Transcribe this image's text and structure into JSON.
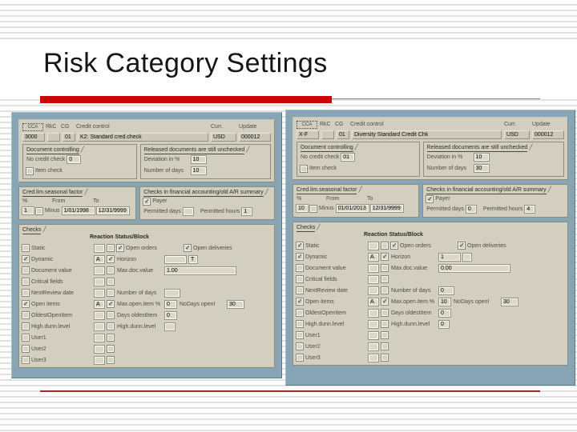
{
  "slide": {
    "title": "Risk Category Settings"
  },
  "panels": [
    {
      "name": "left",
      "header": {
        "icon": "CCA",
        "col_rkc": "RkC",
        "col_cg": "CG",
        "col_desc": "Credit control",
        "col_curr": "Curr.",
        "col_update": "Update",
        "ccar": "3000",
        "rkc": "",
        "cg": "01",
        "desc": "K2: Standard cred.check",
        "curr": "USD",
        "update": "000012"
      },
      "doc_controlling": {
        "title": "Document controlling",
        "no_check_label": "No credit check",
        "no_check_value": "0",
        "item_check_label": "Item check",
        "item_check_checked": false
      },
      "released": {
        "title": "Released documents are still unchecked",
        "deviation_label": "Deviation in %",
        "deviation_value": "10",
        "days_label": "Number of days",
        "days_value": "10"
      },
      "seasonal": {
        "title": "Cred.lim.seasonal factor",
        "pct_label": "%",
        "from_label": "From",
        "to_label": "To",
        "pct_value": "1",
        "minus_label": "Minus",
        "minus_checked": false,
        "from_value": "1/01/1998",
        "to_value": "12/31/9999"
      },
      "fin_summary": {
        "title": "Checks in financial accounting/old A/R summary",
        "payer_label": "Payer",
        "payer_checked": true,
        "days_label": "Permitted days",
        "days_value": "",
        "hours_label": "Permitted hours",
        "hours_value": "1"
      },
      "checks": {
        "title": "Checks",
        "col_header": "Reaction Status/Block",
        "rows": [
          {
            "label": "Static",
            "checked": false,
            "reaction": "",
            "status": false,
            "extras": [
              {
                "kind": "checkbox",
                "label": "Open orders",
                "checked": true
              },
              {
                "kind": "checkbox",
                "label": "Open deliveries",
                "checked": true
              }
            ]
          },
          {
            "label": "Dynamic",
            "checked": true,
            "reaction": "A",
            "status": true,
            "extras": [
              {
                "kind": "field",
                "label": "Horizon",
                "value": "",
                "unit": "T"
              }
            ]
          },
          {
            "label": "Document value",
            "checked": false,
            "reaction": "",
            "status": false,
            "extras": [
              {
                "kind": "field",
                "label": "Max.doc.value",
                "value": "1.00"
              }
            ]
          },
          {
            "label": "Critical fields",
            "checked": false,
            "reaction": "",
            "status": false,
            "extras": []
          },
          {
            "label": "NextReview date",
            "checked": false,
            "reaction": "",
            "status": false,
            "extras": [
              {
                "kind": "field",
                "label": "Number of days",
                "value": ""
              }
            ]
          },
          {
            "label": "Open items",
            "checked": true,
            "reaction": "A",
            "status": true,
            "extras": [
              {
                "kind": "field",
                "label": "Max.open.item %",
                "value": "0"
              },
              {
                "kind": "field",
                "label": "NoDays openI",
                "value": "30"
              }
            ]
          },
          {
            "label": "OldestOpenItem",
            "checked": false,
            "reaction": "",
            "status": false,
            "extras": [
              {
                "kind": "field",
                "label": "Days oldestItem",
                "value": "0"
              }
            ]
          },
          {
            "label": "High.dunn.level",
            "checked": false,
            "reaction": "",
            "status": false,
            "extras": [
              {
                "kind": "field",
                "label": "High.dunn.level",
                "value": ""
              }
            ]
          },
          {
            "label": "User1",
            "checked": false,
            "reaction": "",
            "status": false,
            "extras": []
          },
          {
            "label": "User2",
            "checked": false,
            "reaction": "",
            "status": false,
            "extras": []
          },
          {
            "label": "User3",
            "checked": false,
            "reaction": "",
            "status": false,
            "extras": []
          }
        ]
      }
    },
    {
      "name": "right",
      "header": {
        "icon": "CCA",
        "col_rkc": "RkC",
        "col_cg": "CG",
        "col_desc": "Credit control",
        "col_curr": "Curr.",
        "col_update": "Update",
        "ccar": "X-F",
        "rkc": "",
        "cg": "01",
        "desc": "Diversity Standard Credit Chk",
        "curr": "USD",
        "update": "000012"
      },
      "doc_controlling": {
        "title": "Document controlling",
        "no_check_label": "No credit check",
        "no_check_value": "01",
        "item_check_label": "Item check",
        "item_check_checked": false
      },
      "released": {
        "title": "Released documents are still unchecked",
        "deviation_label": "Deviation in %",
        "deviation_value": "10",
        "days_label": "Number of days",
        "days_value": "30"
      },
      "seasonal": {
        "title": "Cred.lim.seasonal factor",
        "pct_label": "%",
        "from_label": "From",
        "to_label": "To",
        "pct_value": "10",
        "minus_label": "Minus",
        "minus_checked": false,
        "from_value": "01/01/2013",
        "to_value": "12/31/9999"
      },
      "fin_summary": {
        "title": "Checks in financial accounting/old A/R summary",
        "payer_label": "Payer",
        "payer_checked": true,
        "days_label": "Permitted days",
        "days_value": "0",
        "hours_label": "Permitted hours",
        "hours_value": "4"
      },
      "checks": {
        "title": "Checks",
        "col_header": "Reaction Status/Block",
        "rows": [
          {
            "label": "Static",
            "checked": true,
            "reaction": "",
            "status": false,
            "extras": [
              {
                "kind": "checkbox",
                "label": "Open orders",
                "checked": true
              },
              {
                "kind": "checkbox",
                "label": "Open deliveries",
                "checked": true
              }
            ]
          },
          {
            "label": "Dynamic",
            "checked": true,
            "reaction": "A",
            "status": true,
            "extras": [
              {
                "kind": "field",
                "label": "Horizon",
                "value": "1",
                "unit": ""
              }
            ]
          },
          {
            "label": "Document value",
            "checked": false,
            "reaction": "",
            "status": false,
            "extras": [
              {
                "kind": "field",
                "label": "Max.doc.value",
                "value": "0.00"
              }
            ]
          },
          {
            "label": "Critical fields",
            "checked": false,
            "reaction": "",
            "status": false,
            "extras": []
          },
          {
            "label": "NextReview date",
            "checked": false,
            "reaction": "",
            "status": false,
            "extras": [
              {
                "kind": "field",
                "label": "Number of days",
                "value": "0"
              }
            ]
          },
          {
            "label": "Open items",
            "checked": true,
            "reaction": "A",
            "status": true,
            "extras": [
              {
                "kind": "field",
                "label": "Max.open.item %",
                "value": "10"
              },
              {
                "kind": "field",
                "label": "NoDays openI",
                "value": "30"
              }
            ]
          },
          {
            "label": "OldestOpenItem",
            "checked": false,
            "reaction": "",
            "status": false,
            "extras": [
              {
                "kind": "field",
                "label": "Days oldestItem",
                "value": "0"
              }
            ]
          },
          {
            "label": "High.dunn.level",
            "checked": false,
            "reaction": "",
            "status": false,
            "extras": [
              {
                "kind": "field",
                "label": "High.dunn.level",
                "value": "0"
              }
            ]
          },
          {
            "label": "User1",
            "checked": false,
            "reaction": "",
            "status": false,
            "extras": []
          },
          {
            "label": "User2",
            "checked": false,
            "reaction": "",
            "status": false,
            "extras": []
          },
          {
            "label": "User3",
            "checked": false,
            "reaction": "",
            "status": false,
            "extras": []
          }
        ]
      }
    }
  ]
}
